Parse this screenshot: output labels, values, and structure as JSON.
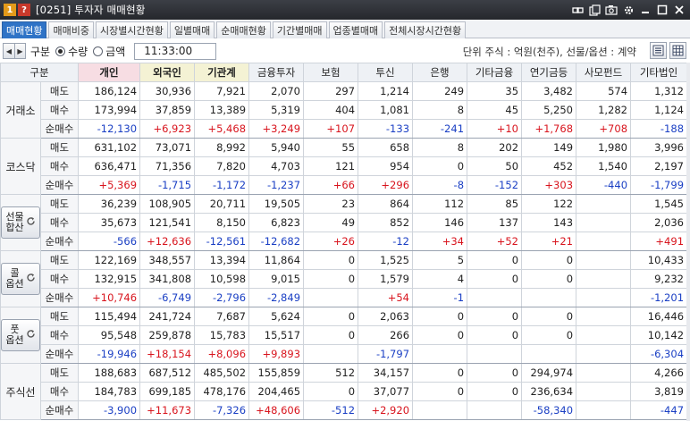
{
  "window": {
    "badge_one": "1",
    "badge_q": "?",
    "title": "[0251] 투자자 매매현황",
    "icons": [
      "link-icon",
      "copy-icon",
      "camera-icon",
      "gear-icon",
      "minimize-icon",
      "maximize-icon",
      "close-icon"
    ]
  },
  "tabs": [
    "매매현황",
    "매매비중",
    "시장별시간현황",
    "일별매매",
    "순매매현황",
    "기간별매매",
    "업종별매매",
    "전체시장시간현황"
  ],
  "toolbar": {
    "gubun_label": "구분",
    "radio_qty": "수량",
    "radio_amount": "금액",
    "time_value": "11:33:00",
    "unit_text": "단위 주식 : 억원(천주), 선물/옵션 : 계약"
  },
  "colors": {
    "positive": "#d8141d",
    "negative": "#1a3fc4",
    "active_tab": "#2f73c6"
  },
  "grid": {
    "headers": [
      "구분",
      "개인",
      "외국인",
      "기관계",
      "금융투자",
      "보험",
      "투신",
      "은행",
      "기타금융",
      "연기금등",
      "사모펀드",
      "기타법인"
    ],
    "groups": [
      {
        "name": "거래소",
        "button": false,
        "rows": [
          {
            "label": "매도",
            "values": [
              "186,124",
              "30,936",
              "7,921",
              "2,070",
              "297",
              "1,214",
              "249",
              "35",
              "3,482",
              "574",
              "1,312"
            ]
          },
          {
            "label": "매수",
            "values": [
              "173,994",
              "37,859",
              "13,389",
              "5,319",
              "404",
              "1,081",
              "8",
              "45",
              "5,250",
              "1,282",
              "1,124"
            ]
          },
          {
            "label": "순매수",
            "values": [
              "-12,130",
              "+6,923",
              "+5,468",
              "+3,249",
              "+107",
              "-133",
              "-241",
              "+10",
              "+1,768",
              "+708",
              "-188"
            ]
          }
        ]
      },
      {
        "name": "코스닥",
        "button": false,
        "rows": [
          {
            "label": "매도",
            "values": [
              "631,102",
              "73,071",
              "8,992",
              "5,940",
              "55",
              "658",
              "8",
              "202",
              "149",
              "1,980",
              "3,996"
            ]
          },
          {
            "label": "매수",
            "values": [
              "636,471",
              "71,356",
              "7,820",
              "4,703",
              "121",
              "954",
              "0",
              "50",
              "452",
              "1,540",
              "2,197"
            ]
          },
          {
            "label": "순매수",
            "values": [
              "+5,369",
              "-1,715",
              "-1,172",
              "-1,237",
              "+66",
              "+296",
              "-8",
              "-152",
              "+303",
              "-440",
              "-1,799"
            ]
          }
        ]
      },
      {
        "name": "선물\n합산",
        "button": true,
        "rows": [
          {
            "label": "매도",
            "values": [
              "36,239",
              "108,905",
              "20,711",
              "19,505",
              "23",
              "864",
              "112",
              "85",
              "122",
              "",
              "1,545"
            ]
          },
          {
            "label": "매수",
            "values": [
              "35,673",
              "121,541",
              "8,150",
              "6,823",
              "49",
              "852",
              "146",
              "137",
              "143",
              "",
              "2,036"
            ]
          },
          {
            "label": "순매수",
            "values": [
              "-566",
              "+12,636",
              "-12,561",
              "-12,682",
              "+26",
              "-12",
              "+34",
              "+52",
              "+21",
              "",
              "+491"
            ]
          }
        ]
      },
      {
        "name": "콜\n옵션",
        "button": true,
        "rows": [
          {
            "label": "매도",
            "values": [
              "122,169",
              "348,557",
              "13,394",
              "11,864",
              "0",
              "1,525",
              "5",
              "0",
              "0",
              "",
              "10,433"
            ]
          },
          {
            "label": "매수",
            "values": [
              "132,915",
              "341,808",
              "10,598",
              "9,015",
              "0",
              "1,579",
              "4",
              "0",
              "0",
              "",
              "9,232"
            ]
          },
          {
            "label": "순매수",
            "values": [
              "+10,746",
              "-6,749",
              "-2,796",
              "-2,849",
              "",
              "+54",
              "-1",
              "",
              "",
              "",
              "-1,201"
            ]
          }
        ]
      },
      {
        "name": "풋\n옵션",
        "button": true,
        "rows": [
          {
            "label": "매도",
            "values": [
              "115,494",
              "241,724",
              "7,687",
              "5,624",
              "0",
              "2,063",
              "0",
              "0",
              "0",
              "",
              "16,446"
            ]
          },
          {
            "label": "매수",
            "values": [
              "95,548",
              "259,878",
              "15,783",
              "15,517",
              "0",
              "266",
              "0",
              "0",
              "0",
              "",
              "10,142"
            ]
          },
          {
            "label": "순매수",
            "values": [
              "-19,946",
              "+18,154",
              "+8,096",
              "+9,893",
              "",
              "-1,797",
              "",
              "",
              "",
              "",
              "-6,304"
            ]
          }
        ]
      },
      {
        "name": "주식선",
        "button": false,
        "rows": [
          {
            "label": "매도",
            "values": [
              "188,683",
              "687,512",
              "485,502",
              "155,859",
              "512",
              "34,157",
              "0",
              "0",
              "294,974",
              "",
              "4,266"
            ]
          },
          {
            "label": "매수",
            "values": [
              "184,783",
              "699,185",
              "478,176",
              "204,465",
              "0",
              "37,077",
              "0",
              "0",
              "236,634",
              "",
              "3,819"
            ]
          },
          {
            "label": "순매수",
            "values": [
              "-3,900",
              "+11,673",
              "-7,326",
              "+48,606",
              "-512",
              "+2,920",
              "",
              "",
              "-58,340",
              "",
              "-447"
            ]
          }
        ]
      }
    ]
  }
}
